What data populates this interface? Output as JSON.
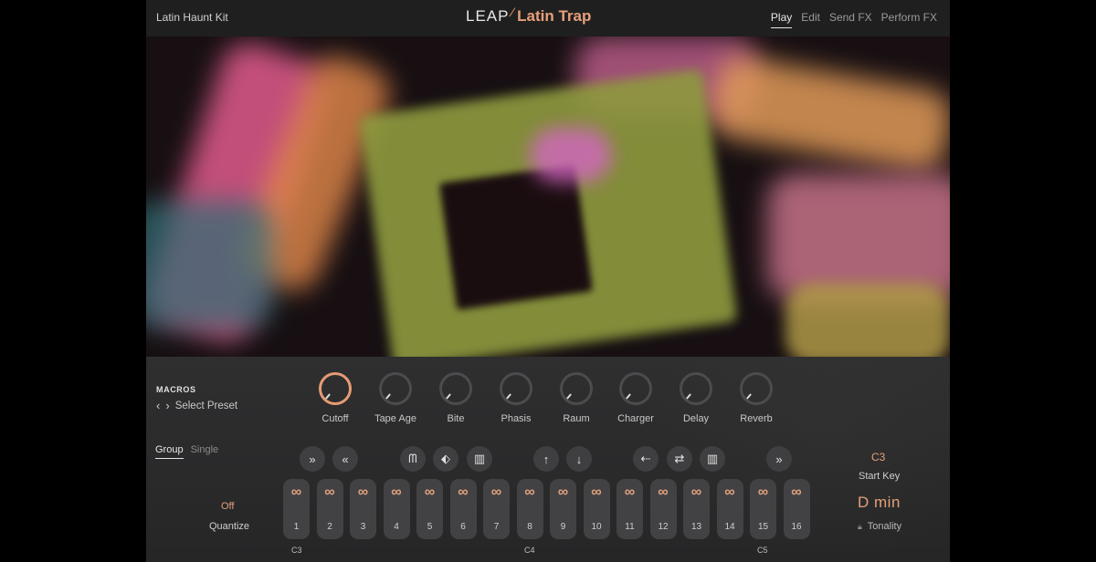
{
  "header": {
    "kit_name": "Latin Haunt Kit",
    "logo_leap": "LEAP",
    "logo_name": "Latin Trap",
    "tabs": [
      {
        "label": "Play",
        "active": true
      },
      {
        "label": "Edit",
        "active": false
      },
      {
        "label": "Send FX",
        "active": false
      },
      {
        "label": "Perform FX",
        "active": false
      }
    ]
  },
  "macros": {
    "title": "MACROS",
    "preset_label": "Select Preset",
    "knobs": [
      {
        "label": "Cutoff",
        "active": true
      },
      {
        "label": "Tape Age",
        "active": false
      },
      {
        "label": "Bite",
        "active": false
      },
      {
        "label": "Phasis",
        "active": false
      },
      {
        "label": "Raum",
        "active": false
      },
      {
        "label": "Charger",
        "active": false
      },
      {
        "label": "Delay",
        "active": false
      },
      {
        "label": "Reverb",
        "active": false
      }
    ]
  },
  "mode_tabs": [
    {
      "label": "Group",
      "active": true
    },
    {
      "label": "Single",
      "active": false
    }
  ],
  "controls": [
    {
      "name": "fast-forward-icon",
      "glyph": "»"
    },
    {
      "name": "rewind-icon",
      "glyph": "«"
    },
    {
      "name": "waveform-icon",
      "glyph": "ᗰ"
    },
    {
      "name": "pattern-icon",
      "glyph": "⬖"
    },
    {
      "name": "bars-icon",
      "glyph": "▥"
    },
    {
      "name": "arrow-up-icon",
      "glyph": "↑"
    },
    {
      "name": "arrow-down-icon",
      "glyph": "↓"
    },
    {
      "name": "dots-arrow-icon",
      "glyph": "⇠"
    },
    {
      "name": "swap-icon",
      "glyph": "⇄"
    },
    {
      "name": "bars-icon",
      "glyph": "▥"
    },
    {
      "name": "fast-forward-icon",
      "glyph": "»"
    }
  ],
  "start_key": {
    "value": "C3",
    "label": "Start Key"
  },
  "tonality": {
    "value": "D  min",
    "label": "Tonality"
  },
  "quantize": {
    "value": "Off",
    "label": "Quantize"
  },
  "pads": {
    "icon": "∞",
    "numbers": [
      "1",
      "2",
      "3",
      "4",
      "5",
      "6",
      "7",
      "8",
      "9",
      "10",
      "11",
      "12",
      "13",
      "14",
      "15",
      "16"
    ]
  },
  "octave_labels": [
    "C3",
    "C4",
    "C5"
  ],
  "colors": {
    "accent": "#e5a078",
    "background": "#2b2b2c"
  }
}
